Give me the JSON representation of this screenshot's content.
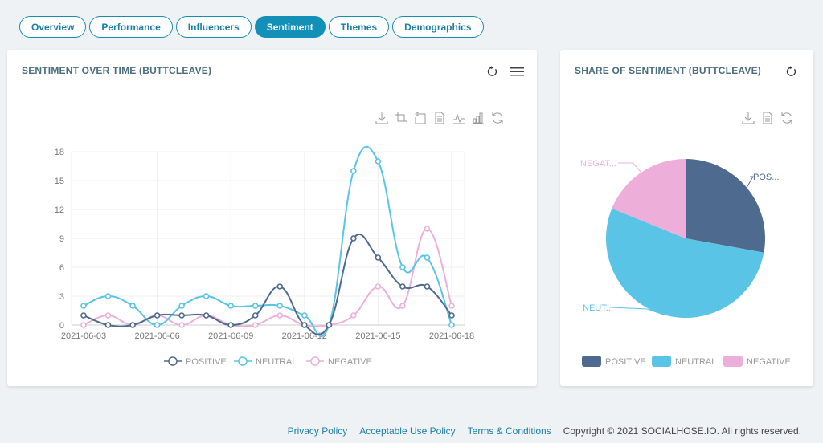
{
  "tabs": [
    {
      "label": "Overview",
      "active": false
    },
    {
      "label": "Performance",
      "active": false
    },
    {
      "label": "Influencers",
      "active": false
    },
    {
      "label": "Sentiment",
      "active": true
    },
    {
      "label": "Themes",
      "active": false
    },
    {
      "label": "Demographics",
      "active": false
    }
  ],
  "line_card": {
    "title": "SENTIMENT OVER TIME (BUTTCLEAVE)",
    "header_icons": [
      "refresh-icon",
      "menu-icon"
    ],
    "toolbox": [
      "download-icon",
      "zoom-icon",
      "zoom-reset-icon",
      "data-view-icon",
      "line-type-icon",
      "bar-type-icon",
      "restore-icon"
    ]
  },
  "pie_card": {
    "title": "SHARE OF SENTIMENT (BUTTCLEAVE)",
    "header_icons": [
      "refresh-icon"
    ],
    "toolbox": [
      "download-icon",
      "data-view-icon",
      "restore-icon"
    ]
  },
  "colors": {
    "positive": "#4f6a8f",
    "neutral": "#59c4e6",
    "negative": "#edafda",
    "accent": "#1390b8"
  },
  "chart_data": [
    {
      "type": "line",
      "title": "SENTIMENT OVER TIME (BUTTCLEAVE)",
      "x": [
        "2021-06-03",
        "2021-06-04",
        "2021-06-05",
        "2021-06-06",
        "2021-06-07",
        "2021-06-08",
        "2021-06-09",
        "2021-06-10",
        "2021-06-11",
        "2021-06-12",
        "2021-06-13",
        "2021-06-14",
        "2021-06-15",
        "2021-06-16",
        "2021-06-17",
        "2021-06-18"
      ],
      "x_tick_labels": [
        "2021-06-03",
        "2021-06-06",
        "2021-06-09",
        "2021-06-12",
        "2021-06-15",
        "2021-06-18"
      ],
      "y_ticks": [
        0,
        3,
        6,
        9,
        12,
        15,
        18
      ],
      "ylim": [
        0,
        18
      ],
      "grid": true,
      "smooth": true,
      "legend_position": "bottom",
      "series": [
        {
          "name": "POSITIVE",
          "color": "#4f6a8f",
          "values": [
            1,
            0,
            0,
            1,
            1,
            1,
            0,
            1,
            4,
            0,
            0,
            9,
            7,
            4,
            4,
            1
          ]
        },
        {
          "name": "NEUTRAL",
          "color": "#59c4e6",
          "values": [
            2,
            3,
            2,
            0,
            2,
            3,
            2,
            2,
            2,
            1,
            0,
            16,
            17,
            6,
            7,
            0
          ]
        },
        {
          "name": "NEGATIVE",
          "color": "#edafda",
          "values": [
            0,
            1,
            0,
            1,
            0,
            1,
            0,
            0,
            1,
            0,
            0,
            1,
            4,
            2,
            10,
            2
          ]
        }
      ]
    },
    {
      "type": "pie",
      "title": "SHARE OF SENTIMENT (BUTTCLEAVE)",
      "legend_position": "bottom",
      "slices": [
        {
          "name": "POSITIVE",
          "label": "POS...",
          "value": 34,
          "color": "#4f6a8f"
        },
        {
          "name": "NEUTRAL",
          "label": "NEUT...",
          "value": 65,
          "color": "#59c4e6"
        },
        {
          "name": "NEGATIVE",
          "label": "NEGAT...",
          "value": 23,
          "color": "#edafda"
        }
      ]
    }
  ],
  "footer": {
    "links": [
      "Privacy Policy",
      "Acceptable Use Policy",
      "Terms & Conditions"
    ],
    "copyright": "Copyright © 2021 SOCIALHOSE.IO. All rights reserved."
  }
}
